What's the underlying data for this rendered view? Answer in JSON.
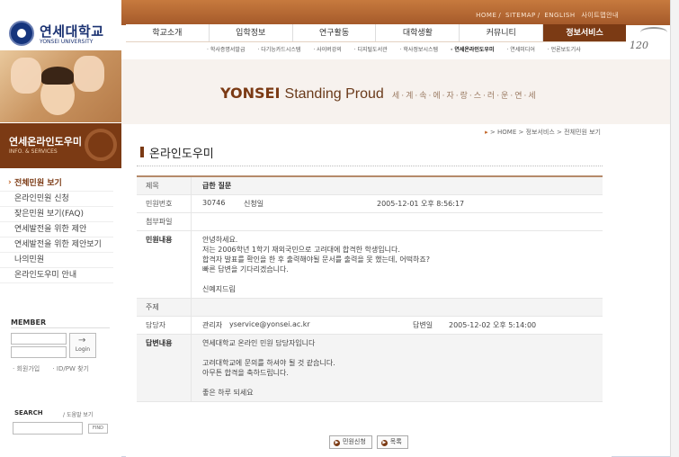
{
  "logo": {
    "name_kr": "연세대학교",
    "name_en": "YONSEI UNIVERSITY"
  },
  "util_nav": [
    "HOME",
    "SITEMAP",
    "ENGLISH",
    "사이트맵안내"
  ],
  "main_nav": [
    "학교소개",
    "입학정보",
    "연구활동",
    "대학생활",
    "커뮤니티",
    "정보서비스"
  ],
  "sub_nav": [
    "학사증명서발급",
    "다기능카드시스템",
    "사이버강의",
    "디지털도서관",
    "학사정보시스템",
    "연세온라인도우미",
    "연세미디어",
    "언론보도기사"
  ],
  "emblem_text": "120",
  "banner": {
    "brand": "YONSEI",
    "slogan": "Standing Proud",
    "korean": "세·계·속·에·자·랑·스·러·운·연·세"
  },
  "section": {
    "title": "연세온라인도우미",
    "subtitle": "INFO. & SERVICES"
  },
  "side_nav": [
    {
      "label": "전체민원 보기",
      "active": true
    },
    {
      "label": "온라인민원 신청"
    },
    {
      "label": "잦은민원 보기(FAQ)"
    },
    {
      "label": "연세발전을 위한 제안"
    },
    {
      "label": "연세발전을 위한 제안보기"
    },
    {
      "label": "나의민원"
    },
    {
      "label": "온라인도우미 안내"
    }
  ],
  "member": {
    "title": "MEMBER",
    "login_label": "Login",
    "links": [
      "회원가입",
      "ID/PW 찾기"
    ]
  },
  "search": {
    "title": "SEARCH",
    "help": "도움말 보기",
    "find": "FIND"
  },
  "breadcrumb": [
    "HOME",
    "정보서비스",
    "전체민원 보기"
  ],
  "page_title": "온라인도우미",
  "post": {
    "subject_label": "제목",
    "subject": "급한 질문",
    "number_label": "민원번호",
    "number": "30746",
    "author": "신청일",
    "date": "2005-12-01 오후 8:56:17",
    "attachment_label": "첨부파일",
    "content_label": "민원내용",
    "content": [
      "안녕하세요.",
      "저는 2006학년 1학기 재외국민으로 고려대에 합격한 학생입니다.",
      "합격자 발표를 확인을 한 후 출력해야될 문서를 출력을 못 했는데, 어떡하죠?",
      "빠른 답변을 기다리겠습니다.",
      "",
      "신예지드림"
    ],
    "topic_label": "주제",
    "topic": "",
    "responder_label": "담당자",
    "responder": "관리자",
    "responder_email": "yservice@yonsei.ac.kr",
    "answer_date_label": "답변일",
    "answer_date": "2005-12-02 오후 5:14:00",
    "answer_label": "답변내용",
    "answer": [
      "연세대학교 온라인 민원 담당자입니다",
      "",
      "고려대학교에 문의를 하셔야 될 것 같습니다.",
      "아무튼 합격을 축하드립니다.",
      "",
      "좋은 하루 되세요"
    ]
  },
  "buttons": {
    "apply": "민원신청",
    "list": "목록"
  }
}
